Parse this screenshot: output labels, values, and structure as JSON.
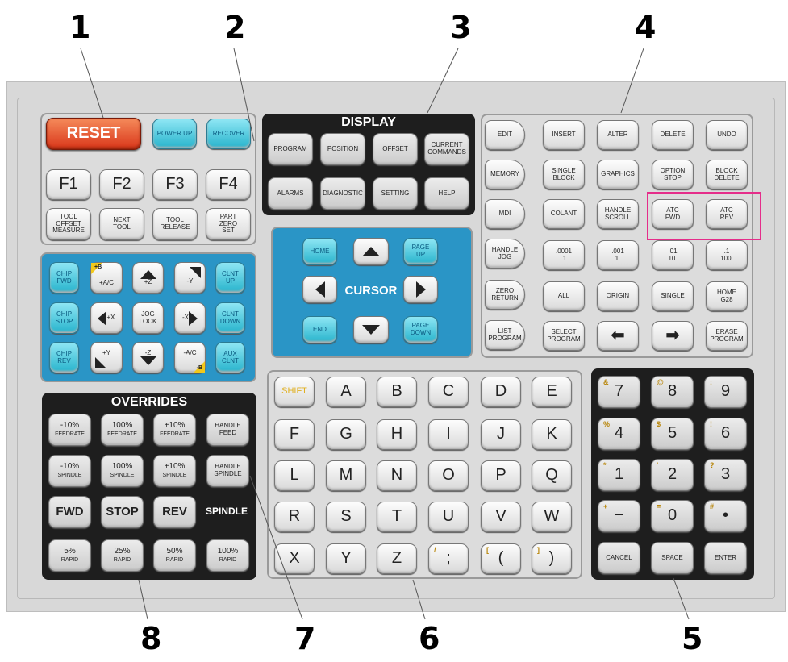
{
  "callouts": [
    "1",
    "2",
    "3",
    "4",
    "5",
    "6",
    "7",
    "8"
  ],
  "sections": {
    "display_title": "DISPLAY",
    "cursor_label": "CURSOR",
    "overrides_title": "OVERRIDES",
    "spindle_label": "SPINDLE"
  },
  "function_keys": {
    "reset": "RESET",
    "power_up": "POWER UP",
    "recover": "RECOVER",
    "f1": "F1",
    "f2": "F2",
    "f3": "F3",
    "f4": "F4",
    "tool_offset_measure": [
      "TOOL",
      "OFFSET",
      "MEASURE"
    ],
    "next_tool": [
      "NEXT",
      "TOOL"
    ],
    "tool_release": [
      "TOOL",
      "RELEASE"
    ],
    "part_zero_set": [
      "PART",
      "ZERO",
      "SET"
    ]
  },
  "display_keys": {
    "program": "PROGRAM",
    "position": "POSITION",
    "offset": "OFFSET",
    "current_commands": [
      "CURRENT",
      "COMMANDS"
    ],
    "alarms": "ALARMS",
    "diagnostic": "DIAGNOSTIC",
    "setting": "SETTING",
    "help": "HELP"
  },
  "cursor_keys": {
    "home": "HOME",
    "page_up": [
      "PAGE",
      "UP"
    ],
    "end": "END",
    "page_down": [
      "PAGE",
      "DOWN"
    ]
  },
  "mode_keys": {
    "edit": "EDIT",
    "memory": "MEMORY",
    "mdi": "MDI",
    "handle_jog": [
      "HANDLE",
      "JOG"
    ],
    "zero_return": [
      "ZERO",
      "RETURN"
    ],
    "list_program": [
      "LIST",
      "PROGRAM"
    ],
    "insert": "INSERT",
    "alter": "ALTER",
    "delete": "DELETE",
    "undo": "UNDO",
    "single_block": [
      "SINGLE",
      "BLOCK"
    ],
    "graphics": "GRAPHICS",
    "option_stop": [
      "OPTION",
      "STOP"
    ],
    "block_delete": [
      "BLOCK",
      "DELETE"
    ],
    "coolant": "COLANT",
    "handle_scroll": [
      "HANDLE",
      "SCROLL"
    ],
    "atc_fwd": [
      "ATC",
      "FWD"
    ],
    "atc_rev": [
      "ATC",
      "REV"
    ],
    "jog_0001": [
      ".0001",
      ".1"
    ],
    "jog_001": [
      ".001",
      "1."
    ],
    "jog_01": [
      ".01",
      "10."
    ],
    "jog_1": [
      ".1",
      "100."
    ],
    "all": "ALL",
    "origin": "ORIGIN",
    "single": "SINGLE",
    "home_g28": [
      "HOME",
      "G28"
    ],
    "select_program": [
      "SELECT",
      "PROGRAM"
    ],
    "erase_program": [
      "ERASE",
      "PROGRAM"
    ]
  },
  "jog_keys": {
    "chip_fwd": [
      "CHIP",
      "FWD"
    ],
    "plus_a": "+A/C",
    "plus_b_sup": "+B",
    "plus_z": "+Z",
    "minus_y": "-Y",
    "clnt_up": [
      "CLNT",
      "UP"
    ],
    "chip_stop": [
      "CHIP",
      "STOP"
    ],
    "plus_x": "+X",
    "jog_lock": [
      "JOG",
      "LOCK"
    ],
    "minus_x": "-X",
    "clnt_down": [
      "CLNT",
      "DOWN"
    ],
    "chip_rev": [
      "CHIP",
      "REV"
    ],
    "plus_y": "+Y",
    "minus_z": "-Z",
    "minus_a": "-A/C",
    "minus_b_sup": "-B",
    "aux_clnt": [
      "AUX",
      "CLNT"
    ]
  },
  "alpha_keys": {
    "shift": "SHIFT",
    "rows": [
      [
        "A",
        "B",
        "C",
        "D",
        "E"
      ],
      [
        "F",
        "G",
        "H",
        "I",
        "J",
        "K"
      ],
      [
        "L",
        "M",
        "N",
        "O",
        "P",
        "Q"
      ],
      [
        "R",
        "S",
        "T",
        "U",
        "V",
        "W"
      ],
      [
        "X",
        "Y",
        "Z",
        ";",
        "(",
        ")"
      ]
    ],
    "semicolon_sup": "/",
    "lparen_sup": "[",
    "rparen_sup": "]"
  },
  "numeric_keys": {
    "rows": [
      [
        "7",
        "8",
        "9"
      ],
      [
        "4",
        "5",
        "6"
      ],
      [
        "1",
        "2",
        "3"
      ],
      [
        "−",
        "0",
        "•"
      ]
    ],
    "sups": [
      [
        "&",
        "@",
        ":"
      ],
      [
        "%",
        "$",
        "!"
      ],
      [
        "*",
        "'",
        "?"
      ],
      [
        "+",
        "=",
        "#"
      ]
    ],
    "cancel": "CANCEL",
    "space": "SPACE",
    "enter": "ENTER"
  },
  "override_keys": {
    "feed_minus": [
      "-10%",
      "FEEDRATE"
    ],
    "feed_100": [
      "100%",
      "FEEDRATE"
    ],
    "feed_plus": [
      "+10%",
      "FEEDRATE"
    ],
    "handle_feed": [
      "HANDLE",
      "FEED"
    ],
    "spin_minus": [
      "-10%",
      "SPINDLE"
    ],
    "spin_100": [
      "100%",
      "SPINDLE"
    ],
    "spin_plus": [
      "+10%",
      "SPINDLE"
    ],
    "handle_spindle": [
      "HANDLE",
      "SPINDLE"
    ],
    "fwd": "FWD",
    "stop": "STOP",
    "rev": "REV",
    "rapid_5": [
      "5%",
      "RAPID"
    ],
    "rapid_25": [
      "25%",
      "RAPID"
    ],
    "rapid_50": [
      "50%",
      "RAPID"
    ],
    "rapid_100": [
      "100%",
      "RAPID"
    ]
  },
  "colors": {
    "highlight": "#e52d8a",
    "cursor_panel": "#2a95c6",
    "reset": "#d9361a",
    "cyan_key": "#26b3cc"
  }
}
